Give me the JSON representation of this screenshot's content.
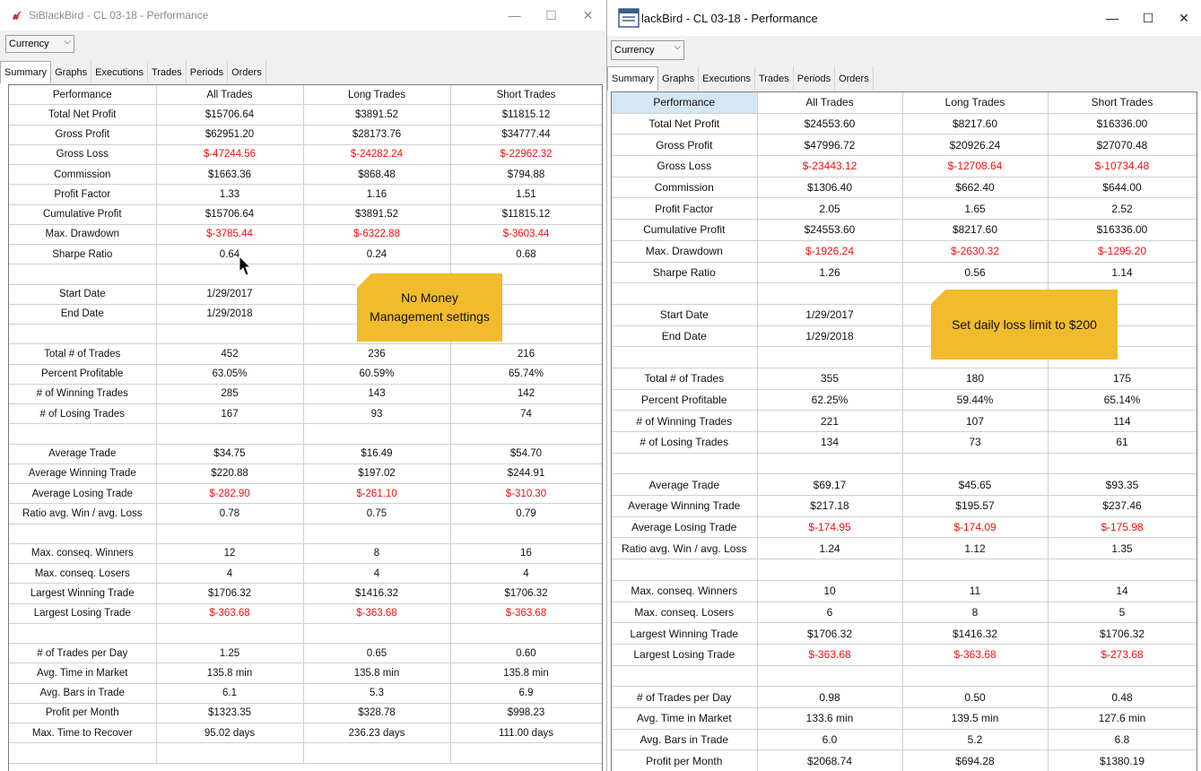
{
  "left_window": {
    "title": "SiBlackBird - CL 03-18 - Performance",
    "view_select": "Currency",
    "tabs": [
      "Summary",
      "Graphs",
      "Executions",
      "Trades",
      "Periods",
      "Orders"
    ],
    "active_tab": "Summary",
    "columns": [
      "Performance",
      "All Trades",
      "Long Trades",
      "Short Trades"
    ],
    "rows": [
      [
        "Total Net Profit",
        "$15706.64",
        "$3891.52",
        "$11815.12"
      ],
      [
        "Gross Profit",
        "$62951.20",
        "$28173.76",
        "$34777.44"
      ],
      [
        "Gross Loss",
        "$-47244.56",
        "$-24282.24",
        "$-22962.32"
      ],
      [
        "Commission",
        "$1663.36",
        "$868.48",
        "$794.88"
      ],
      [
        "Profit Factor",
        "1.33",
        "1.16",
        "1.51"
      ],
      [
        "Cumulative Profit",
        "$15706.64",
        "$3891.52",
        "$11815.12"
      ],
      [
        "Max. Drawdown",
        "$-3785.44",
        "$-6322.88",
        "$-3603.44"
      ],
      [
        "Sharpe Ratio",
        "0.64",
        "0.24",
        "0.68"
      ],
      [
        "",
        "",
        "",
        ""
      ],
      [
        "Start Date",
        "1/29/2017",
        "",
        ""
      ],
      [
        "End Date",
        "1/29/2018",
        "",
        ""
      ],
      [
        "",
        "",
        "",
        ""
      ],
      [
        "Total # of Trades",
        "452",
        "236",
        "216"
      ],
      [
        "Percent Profitable",
        "63.05%",
        "60.59%",
        "65.74%"
      ],
      [
        "# of Winning Trades",
        "285",
        "143",
        "142"
      ],
      [
        "# of Losing Trades",
        "167",
        "93",
        "74"
      ],
      [
        "",
        "",
        "",
        ""
      ],
      [
        "Average Trade",
        "$34.75",
        "$16.49",
        "$54.70"
      ],
      [
        "Average Winning Trade",
        "$220.88",
        "$197.02",
        "$244.91"
      ],
      [
        "Average Losing Trade",
        "$-282.90",
        "$-261.10",
        "$-310.30"
      ],
      [
        "Ratio avg. Win / avg. Loss",
        "0.78",
        "0.75",
        "0.79"
      ],
      [
        "",
        "",
        "",
        ""
      ],
      [
        "Max. conseq. Winners",
        "12",
        "8",
        "16"
      ],
      [
        "Max. conseq. Losers",
        "4",
        "4",
        "4"
      ],
      [
        "Largest Winning Trade",
        "$1706.32",
        "$1416.32",
        "$1706.32"
      ],
      [
        "Largest Losing Trade",
        "$-363.68",
        "$-363.68",
        "$-363.68"
      ],
      [
        "",
        "",
        "",
        ""
      ],
      [
        "# of Trades per Day",
        "1.25",
        "0.65",
        "0.60"
      ],
      [
        "Avg. Time in Market",
        "135.8 min",
        "135.8 min",
        "135.8 min"
      ],
      [
        "Avg. Bars in Trade",
        "6.1",
        "5.3",
        "6.9"
      ],
      [
        "Profit per Month",
        "$1323.35",
        "$328.78",
        "$998.23"
      ],
      [
        "Max. Time to Recover",
        "95.02 days",
        "236.23 days",
        "111.00 days"
      ],
      [
        "",
        "",
        "",
        ""
      ]
    ],
    "callout": [
      "No Money",
      "Management settings"
    ]
  },
  "right_window": {
    "title": "lackBird - CL 03-18 - Performance",
    "view_select": "Currency",
    "tabs": [
      "Summary",
      "Graphs",
      "Executions",
      "Trades",
      "Periods",
      "Orders"
    ],
    "active_tab": "Summary",
    "columns": [
      "Performance",
      "All Trades",
      "Long Trades",
      "Short Trades"
    ],
    "rows": [
      [
        "Total Net Profit",
        "$24553.60",
        "$8217.60",
        "$16336.00"
      ],
      [
        "Gross Profit",
        "$47996.72",
        "$20926.24",
        "$27070.48"
      ],
      [
        "Gross Loss",
        "$-23443.12",
        "$-12708.64",
        "$-10734.48"
      ],
      [
        "Commission",
        "$1306.40",
        "$662.40",
        "$644.00"
      ],
      [
        "Profit Factor",
        "2.05",
        "1.65",
        "2.52"
      ],
      [
        "Cumulative Profit",
        "$24553.60",
        "$8217.60",
        "$16336.00"
      ],
      [
        "Max. Drawdown",
        "$-1926.24",
        "$-2630.32",
        "$-1295.20"
      ],
      [
        "Sharpe Ratio",
        "1.26",
        "0.56",
        "1.14"
      ],
      [
        "",
        "",
        "",
        ""
      ],
      [
        "Start Date",
        "1/29/2017",
        "",
        ""
      ],
      [
        "End Date",
        "1/29/2018",
        "",
        ""
      ],
      [
        "",
        "",
        "",
        ""
      ],
      [
        "Total # of Trades",
        "355",
        "180",
        "175"
      ],
      [
        "Percent Profitable",
        "62.25%",
        "59.44%",
        "65.14%"
      ],
      [
        "# of Winning Trades",
        "221",
        "107",
        "114"
      ],
      [
        "# of Losing Trades",
        "134",
        "73",
        "61"
      ],
      [
        "",
        "",
        "",
        ""
      ],
      [
        "Average Trade",
        "$69.17",
        "$45.65",
        "$93.35"
      ],
      [
        "Average Winning Trade",
        "$217.18",
        "$195.57",
        "$237.46"
      ],
      [
        "Average Losing Trade",
        "$-174.95",
        "$-174.09",
        "$-175.98"
      ],
      [
        "Ratio avg. Win / avg. Loss",
        "1.24",
        "1.12",
        "1.35"
      ],
      [
        "",
        "",
        "",
        ""
      ],
      [
        "Max. conseq. Winners",
        "10",
        "11",
        "14"
      ],
      [
        "Max. conseq. Losers",
        "6",
        "8",
        "5"
      ],
      [
        "Largest Winning Trade",
        "$1706.32",
        "$1416.32",
        "$1706.32"
      ],
      [
        "Largest Losing Trade",
        "$-363.68",
        "$-363.68",
        "$-273.68"
      ],
      [
        "",
        "",
        "",
        ""
      ],
      [
        "# of Trades per Day",
        "0.98",
        "0.50",
        "0.48"
      ],
      [
        "Avg. Time in Market",
        "133.6 min",
        "139.5 min",
        "127.6 min"
      ],
      [
        "Avg. Bars in Trade",
        "6.0",
        "5.2",
        "6.8"
      ],
      [
        "Profit per Month",
        "$2068.74",
        "$694.28",
        "$1380.19"
      ]
    ],
    "callout": [
      "Set daily loss limit to $200"
    ]
  },
  "window_controls": {
    "minimize": "—",
    "maximize": "☐",
    "close": "✕"
  },
  "colors": {
    "negative": "#ee1111",
    "callout": "#f2bb2c",
    "header_highlight": "#d5e6f5",
    "brand": "#c0392b"
  },
  "icons": {
    "left_app_icon": "bird-logo-icon",
    "right_app_icon": "window-app-icon",
    "cursor": "mouse-cursor-icon"
  }
}
